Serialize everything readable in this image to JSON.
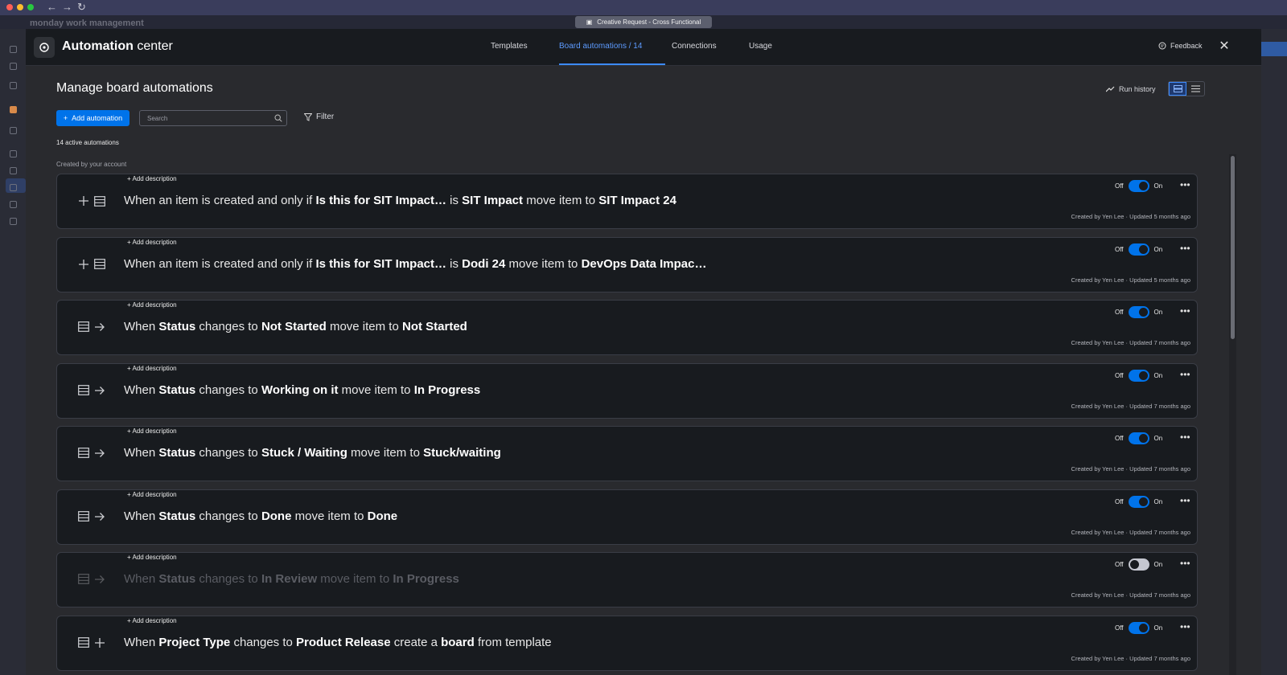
{
  "browser": {
    "tab_title": "Creative Request - Cross Functional",
    "app_name": "monday work management"
  },
  "modal": {
    "title_bold": "Automation",
    "title_rest": " center",
    "tabs": [
      {
        "label": "Templates"
      },
      {
        "label": "Board automations / 14",
        "active": true
      },
      {
        "label": "Connections"
      },
      {
        "label": "Usage"
      }
    ],
    "feedback_label": "Feedback",
    "page_title": "Manage board automations",
    "run_history_label": "Run history",
    "add_button_label": "Add automation",
    "search_placeholder": "Search",
    "filter_label": "Filter",
    "active_count": "14 active automations",
    "section_label": "Created by your account",
    "accent_color": "#0073ea"
  },
  "automations": [
    {
      "description_link": "+ Add description",
      "parts": [
        "When an item is created and only if ",
        "Is this for SIT Impact…",
        "  is ",
        "SIT Impact",
        " move item to ",
        "SIT Impact 24"
      ],
      "off_label": "Off",
      "on_label": "On",
      "enabled": true,
      "meta": "Created by Yen Lee · Updated 5 months ago",
      "icons": [
        "plus-icon",
        "board-icon"
      ]
    },
    {
      "description_link": "+ Add description",
      "parts": [
        "When an item is created and only if ",
        "Is this for SIT Impact…",
        "  is ",
        "Dodi 24",
        " move item to ",
        "DevOps Data Impac…"
      ],
      "off_label": "Off",
      "on_label": "On",
      "enabled": true,
      "meta": "Created by Yen Lee · Updated 5 months ago",
      "icons": [
        "plus-icon",
        "board-icon"
      ]
    },
    {
      "description_link": "+ Add description",
      "parts": [
        "When ",
        "Status",
        " changes to ",
        "Not Started",
        " move item to ",
        "Not Started"
      ],
      "off_label": "Off",
      "on_label": "On",
      "enabled": true,
      "meta": "Created by Yen Lee · Updated 7 months ago",
      "icons": [
        "board-icon",
        "arrow-right-icon"
      ]
    },
    {
      "description_link": "+ Add description",
      "parts": [
        "When ",
        "Status",
        " changes to ",
        "Working on it",
        " move item to ",
        "In Progress"
      ],
      "off_label": "Off",
      "on_label": "On",
      "enabled": true,
      "meta": "Created by Yen Lee · Updated 7 months ago",
      "icons": [
        "board-icon",
        "arrow-right-icon"
      ]
    },
    {
      "description_link": "+ Add description",
      "parts": [
        "When ",
        "Status",
        " changes to ",
        "Stuck / Waiting",
        " move item to ",
        "Stuck/waiting"
      ],
      "off_label": "Off",
      "on_label": "On",
      "enabled": true,
      "meta": "Created by Yen Lee · Updated 7 months ago",
      "icons": [
        "board-icon",
        "arrow-right-icon"
      ]
    },
    {
      "description_link": "+ Add description",
      "parts": [
        "When ",
        "Status",
        " changes to ",
        "Done",
        " move item to ",
        "Done"
      ],
      "off_label": "Off",
      "on_label": "On",
      "enabled": true,
      "meta": "Created by Yen Lee · Updated 7 months ago",
      "icons": [
        "board-icon",
        "arrow-right-icon"
      ]
    },
    {
      "description_link": "+ Add description",
      "parts": [
        "When ",
        "Status",
        " changes to ",
        "In Review",
        " move item to ",
        "In Progress"
      ],
      "off_label": "Off",
      "on_label": "On",
      "enabled": false,
      "meta": "Created by Yen Lee · Updated 7 months ago",
      "icons": [
        "board-icon",
        "arrow-right-icon"
      ]
    },
    {
      "description_link": "+ Add description",
      "parts": [
        "When ",
        "Project Type",
        " changes to ",
        "Product Release",
        " create a ",
        "board",
        " from template"
      ],
      "off_label": "Off",
      "on_label": "On",
      "enabled": true,
      "meta": "Created by Yen Lee · Updated 7 months ago",
      "icons": [
        "board-icon",
        "plus-icon"
      ]
    }
  ]
}
